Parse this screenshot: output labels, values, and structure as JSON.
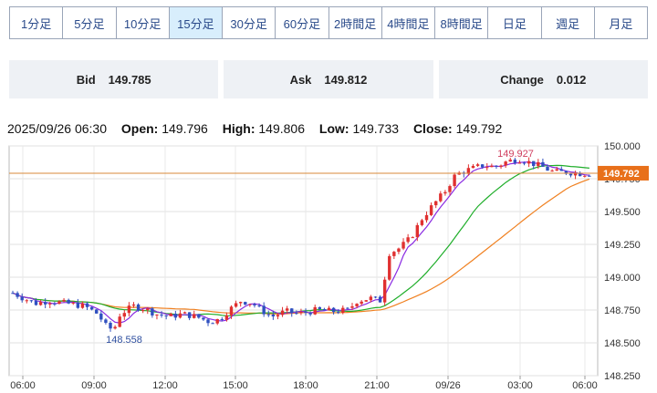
{
  "tabs": [
    {
      "label": "1分足",
      "active": false
    },
    {
      "label": "5分足",
      "active": false
    },
    {
      "label": "10分足",
      "active": false
    },
    {
      "label": "15分足",
      "active": true
    },
    {
      "label": "30分足",
      "active": false
    },
    {
      "label": "60分足",
      "active": false
    },
    {
      "label": "2時間足",
      "active": false
    },
    {
      "label": "4時間足",
      "active": false
    },
    {
      "label": "8時間足",
      "active": false
    },
    {
      "label": "日足",
      "active": false
    },
    {
      "label": "週足",
      "active": false
    },
    {
      "label": "月足",
      "active": false
    }
  ],
  "quotes": {
    "bid_label": "Bid",
    "bid_value": "149.785",
    "ask_label": "Ask",
    "ask_value": "149.812",
    "change_label": "Change",
    "change_value": "0.012"
  },
  "ohlc": {
    "datetime": "2025/09/26 06:30",
    "open_label": "Open:",
    "open": "149.796",
    "high_label": "High:",
    "high": "149.806",
    "low_label": "Low:",
    "low": "149.733",
    "close_label": "Close:",
    "close": "149.792"
  },
  "chart_data": {
    "type": "candlestick",
    "y_ticks": [
      "150.000",
      "149.750",
      "149.500",
      "149.250",
      "149.000",
      "148.750",
      "148.500",
      "148.250"
    ],
    "ylim": [
      148.25,
      150.0
    ],
    "x_ticks": [
      "06:00",
      "09:00",
      "12:00",
      "15:00",
      "18:00",
      "21:00",
      "09/26",
      "03:00",
      "06:00"
    ],
    "current_price": "149.792",
    "high_annotation": "149.927",
    "low_annotation": "148.558",
    "colors": {
      "up": "#e03030",
      "down": "#3050c0",
      "ma_short": "#8a2be2",
      "ma_mid": "#1fae2a",
      "ma_long": "#f08020",
      "price_line": "#d98a3a"
    }
  }
}
